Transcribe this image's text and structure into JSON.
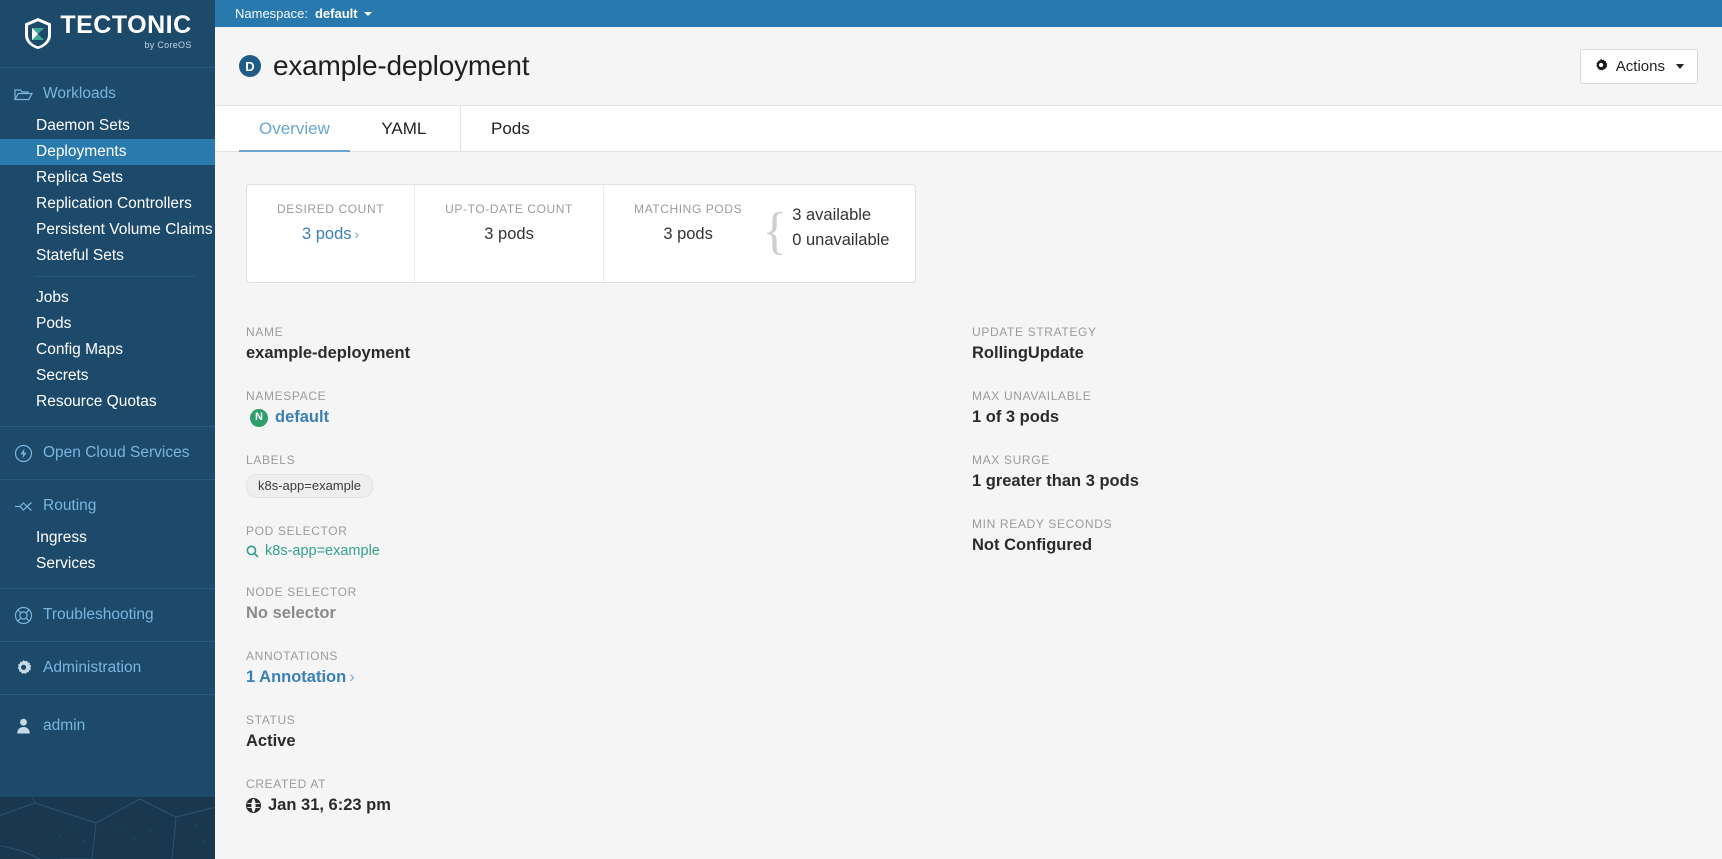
{
  "brand": {
    "name": "TECTONIC",
    "tagline": "by CoreOS",
    "logo_icon": "tectonic-shield-logo"
  },
  "namespace_bar": {
    "label": "Namespace:",
    "value": "default",
    "caret_icon": "chevron-down-icon"
  },
  "sidebar": {
    "sections": [
      {
        "header": {
          "label": "Workloads",
          "icon": "folder-icon"
        },
        "items": [
          {
            "label": "Daemon Sets",
            "active": false
          },
          {
            "label": "Deployments",
            "active": true
          },
          {
            "label": "Replica Sets",
            "active": false
          },
          {
            "label": "Replication Controllers",
            "active": false
          },
          {
            "label": "Persistent Volume Claims",
            "active": false
          },
          {
            "label": "Stateful Sets",
            "active": false
          },
          {
            "label": "__divider__",
            "active": false
          },
          {
            "label": "Jobs",
            "active": false
          },
          {
            "label": "Pods",
            "active": false
          },
          {
            "label": "Config Maps",
            "active": false
          },
          {
            "label": "Secrets",
            "active": false
          },
          {
            "label": "Resource Quotas",
            "active": false
          }
        ]
      },
      {
        "header": {
          "label": "Open Cloud Services",
          "icon": "lightning-circle-icon"
        },
        "items": []
      },
      {
        "header": {
          "label": "Routing",
          "icon": "routing-icon"
        },
        "items": [
          {
            "label": "Ingress",
            "active": false
          },
          {
            "label": "Services",
            "active": false
          }
        ]
      },
      {
        "header": {
          "label": "Troubleshooting",
          "icon": "lifebuoy-icon"
        },
        "items": []
      },
      {
        "header": {
          "label": "Administration",
          "icon": "gear-icon"
        },
        "items": []
      }
    ],
    "user": {
      "label": "admin",
      "icon": "user-icon"
    }
  },
  "page": {
    "kind_badge": "D",
    "title": "example-deployment",
    "actions_button": {
      "label": "Actions",
      "icon": "gear-icon",
      "caret_icon": "caret-down-icon"
    }
  },
  "tabs": [
    {
      "label": "Overview",
      "active": true
    },
    {
      "label": "YAML",
      "active": false
    },
    {
      "label": "Pods",
      "active": false
    }
  ],
  "status_cards": {
    "desired": {
      "label": "Desired Count",
      "value": "3 pods",
      "chevron": "›"
    },
    "up_to_date": {
      "label": "Up-to-date Count",
      "value": "3 pods"
    },
    "matching": {
      "label": "Matching Pods",
      "value": "3 pods"
    },
    "availability": {
      "available": "3 available",
      "unavailable": "0 unavailable"
    }
  },
  "details": {
    "left": {
      "name": {
        "label": "Name",
        "value": "example-deployment"
      },
      "namespace": {
        "label": "Namespace",
        "value": "default",
        "badge": "N"
      },
      "labels": {
        "label": "Labels",
        "tags": [
          "k8s-app=example"
        ]
      },
      "pod_selector": {
        "label": "Pod Selector",
        "value": "k8s-app=example",
        "icon": "search-icon"
      },
      "node_selector": {
        "label": "Node Selector",
        "value": "No selector"
      },
      "annotations": {
        "label": "Annotations",
        "value": "1 Annotation",
        "chevron": "›"
      },
      "status": {
        "label": "Status",
        "value": "Active"
      },
      "created_at": {
        "label": "Created At",
        "value": "Jan 31, 6:23 pm",
        "icon": "globe-icon"
      }
    },
    "right": {
      "update_strategy": {
        "label": "Update Strategy",
        "value": "RollingUpdate"
      },
      "max_unavailable": {
        "label": "Max Unavailable",
        "value": "1 of 3 pods"
      },
      "max_surge": {
        "label": "Max Surge",
        "value": "1 greater than 3 pods"
      },
      "min_ready_seconds": {
        "label": "Min Ready Seconds",
        "value": "Not Configured"
      }
    }
  },
  "colors": {
    "sidebar_bg": "#1d4a6b",
    "sidebar_active": "#2b7aad",
    "sidebar_footer": "#19374e",
    "namespace_bar": "#2779ae",
    "accent_link": "#3a7fb5",
    "nav_header_text": "#7ab5e0",
    "namespace_badge": "#2e9e6b",
    "selector_teal": "#33a08a",
    "page_bg": "#f5f5f5"
  }
}
